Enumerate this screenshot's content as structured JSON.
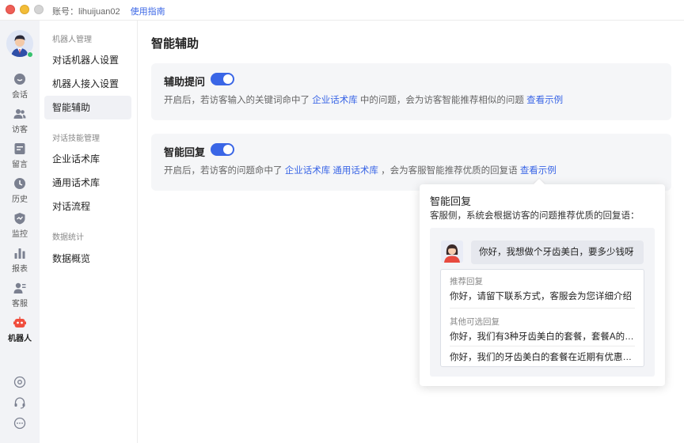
{
  "titlebar": {
    "account": "账号：lihuijuan02",
    "guide": "使用指南"
  },
  "rail": {
    "items": [
      {
        "label": "会话",
        "icon": "chat-icon"
      },
      {
        "label": "访客",
        "icon": "visitors-icon"
      },
      {
        "label": "留言",
        "icon": "message-icon"
      },
      {
        "label": "历史",
        "icon": "history-icon"
      },
      {
        "label": "监控",
        "icon": "monitor-icon"
      },
      {
        "label": "报表",
        "icon": "report-icon"
      },
      {
        "label": "客服",
        "icon": "agent-icon"
      },
      {
        "label": "机器人",
        "icon": "robot-icon",
        "active": true
      }
    ],
    "bottom_icons": [
      "settings-icon",
      "headset-icon",
      "more-icon"
    ]
  },
  "subnav": {
    "groups": [
      {
        "title": "机器人管理",
        "items": [
          "对话机器人设置",
          "机器人接入设置",
          "智能辅助"
        ]
      },
      {
        "title": "对话技能管理",
        "items": [
          "企业话术库",
          "通用话术库",
          "对话流程"
        ]
      },
      {
        "title": "数据统计",
        "items": [
          "数据概览"
        ]
      }
    ],
    "active_item": "智能辅助"
  },
  "main": {
    "title": "智能辅助",
    "cards": [
      {
        "title": "辅助提问",
        "enabled": true,
        "desc_prefix": "开启后，若访客输入的关键词命中了",
        "link1": "企业话术库",
        "desc_mid": "中的问题，会为访客智能推荐相似的问题",
        "example": "查看示例"
      },
      {
        "title": "智能回复",
        "enabled": true,
        "desc_prefix": "开启后，若访客的问题命中了",
        "link1": "企业话术库",
        "link2": "通用话术库",
        "desc_mid": "，会为客服智能推荐优质的回复语",
        "example": "查看示例"
      }
    ]
  },
  "popup": {
    "title": "智能回复",
    "subtitle": "客服侧，系统会根据访客的问题推荐优质的回复语：",
    "visitor_message": "你好，我想做个牙齿美白，要多少钱呀",
    "recommended_label": "推荐回复",
    "recommended_reply": "你好，请留下联系方式，客服会为您详细介绍",
    "other_label": "其他可选回复",
    "other_replies": [
      "你好，我们有3种牙齿美白的套餐，套餐A的…",
      "你好，我们的牙齿美白的套餐在近期有优惠…"
    ]
  },
  "colors": {
    "accent": "#3a66e6",
    "robot_active": "#f04e3e",
    "online": "#36c26d",
    "card_bg": "#f5f6f8"
  }
}
